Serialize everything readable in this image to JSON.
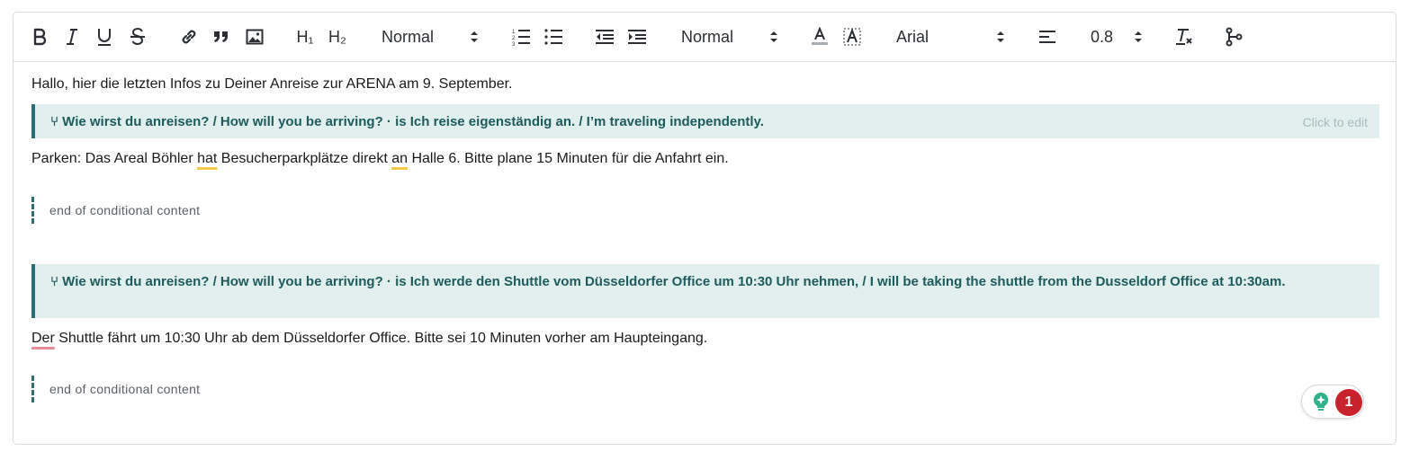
{
  "toolbar": {
    "heading_h1": "H₁",
    "heading_h2": "H₂",
    "block_format": "Normal",
    "font_size": "Normal",
    "font_family": "Arial",
    "line_height": "0.8"
  },
  "content": {
    "intro": "Hallo, hier die letzten Infos zu Deiner Anreise zur ARENA am 9. September.",
    "condition1": {
      "text": "⑂ Wie wirst du anreisen? / How will you be arriving? · is Ich reise eigenständig an. / I’m traveling independently.",
      "edit_hint": "Click to edit"
    },
    "parking": {
      "part1": "Parken: Das Areal Böhler ",
      "w1": "hat",
      "part2": " Besucherparkplätze direkt ",
      "w2": "an",
      "part3": " Halle 6. Bitte plane 15 Minuten für die Anfahrt ein."
    },
    "end1": "end of conditional content",
    "condition2": {
      "text": "⑂ Wie wirst du anreisen? / How will you be arriving? · is Ich werde den Shuttle vom Düsseldorfer Office um 10:30 Uhr nehmen, / I will be taking the shuttle from the Dusseldorf Office at 10:30am."
    },
    "shuttle": {
      "w1": "Der",
      "rest": " Shuttle fährt um 10:30 Uhr ab dem Düsseldorfer Office. Bitte sei 10 Minuten vorher am Haupteingang."
    },
    "end2": "end of conditional content"
  },
  "assistant_badge": {
    "count": "1",
    "accent": "#2fb18a",
    "alert": "#c8232c"
  }
}
